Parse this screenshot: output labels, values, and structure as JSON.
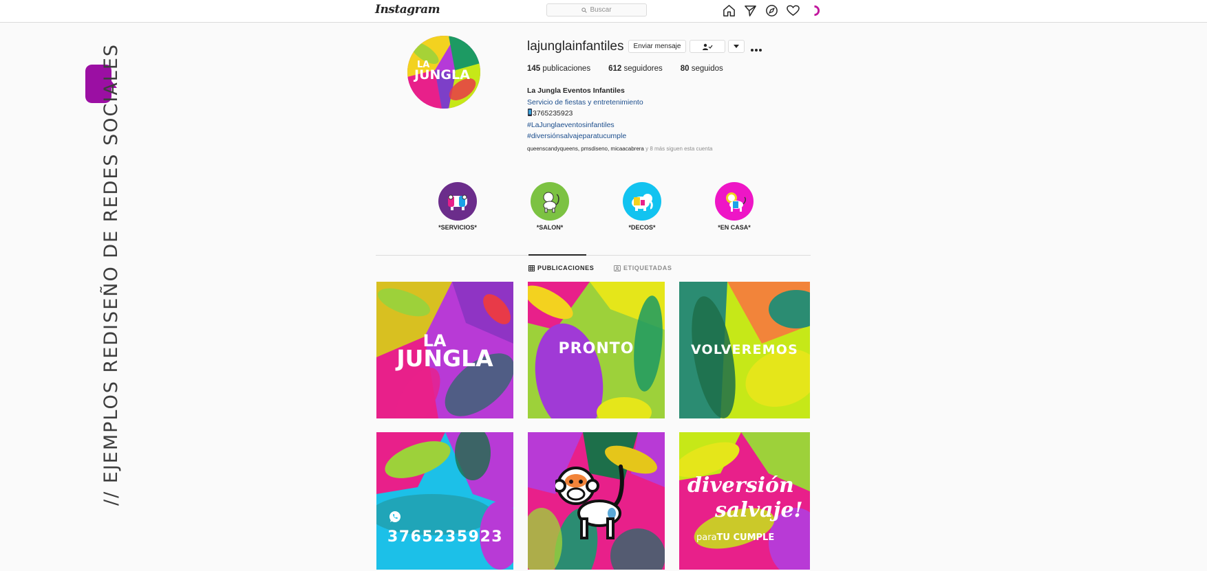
{
  "side_caption": "// EJEMPLOS REDISEÑO DE REDES SOCIALES",
  "topbar": {
    "logo": "Instagram",
    "search_placeholder": "Buscar",
    "icons": [
      "home-icon",
      "direct-icon",
      "explore-icon",
      "activity-heart-icon",
      "profile-avatar-icon"
    ]
  },
  "profile": {
    "avatar_text_top": "LA",
    "avatar_text_bottom": "JUNGLA",
    "username": "lajunglainfantiles",
    "message_button": "Enviar mensaje",
    "following_icon": "person-check-icon",
    "dropdown_icon": "caret-down-icon",
    "more_icon": "more-dots-icon",
    "stats": {
      "posts_count": "145",
      "posts_label": "publicaciones",
      "followers_count": "612",
      "followers_label": "seguidores",
      "following_count": "80",
      "following_label": "seguidos"
    },
    "bio": {
      "name": "La Jungla Eventos Infantiles",
      "category": "Servicio de fiestas y entretenimiento",
      "phone": "3765235923",
      "hashtag1": "#LaJunglaeventosinfantiles",
      "hashtag2": "#diversiónsalvajeparatucumple"
    },
    "followed_by_names": "queenscandyqueens, pmsdiseno, micaacabrera",
    "followed_by_more": " y 8 más siguen esta cuenta"
  },
  "highlights": [
    {
      "label": "*SERVICIOS*",
      "color": "#6b2d8b",
      "icon": "hippo-icon"
    },
    {
      "label": "*SALON*",
      "color": "#7cc242",
      "icon": "monkey-icon"
    },
    {
      "label": "*DECOS*",
      "color": "#12c3f0",
      "icon": "elephant-icon"
    },
    {
      "label": "*EN CASA*",
      "color": "#ee16c6",
      "icon": "lion-icon"
    }
  ],
  "tabs": [
    {
      "label": "PUBLICACIONES",
      "icon": "grid-icon",
      "active": true
    },
    {
      "label": "ETIQUETADAS",
      "icon": "tagged-icon",
      "active": false
    }
  ],
  "posts": [
    {
      "text_top": "LA",
      "text_bottom": "JUNGLA"
    },
    {
      "text": "PRONTO"
    },
    {
      "text": "VOLVEREMOS"
    },
    {
      "icon": "whatsapp-icon",
      "text": "3765235923"
    },
    {
      "icon": "monkey-icon"
    },
    {
      "text_line1": "diversión",
      "text_line2": "salvaje!",
      "text_small_a": "para",
      "text_small_b": "TU CUMPLE"
    }
  ],
  "colors": {
    "brand_purple": "#9b0fa3",
    "link_blue": "#1b4d8c",
    "border": "#dbdbdb"
  }
}
